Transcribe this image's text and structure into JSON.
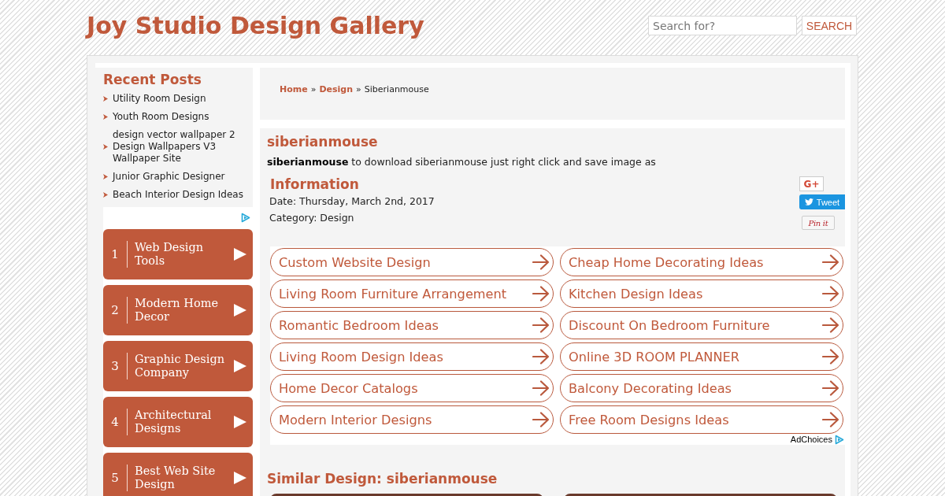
{
  "site_title": "Joy Studio Design Gallery",
  "search": {
    "placeholder": "Search for?",
    "button": "SEARCH"
  },
  "sidebar": {
    "recent_posts": {
      "title": "Recent Posts",
      "items": [
        "Utility Room Design",
        "Youth Room Designs",
        "design vector wallpaper 2 Design Wallpapers V3 Wallpaper Site",
        "Junior Graphic Designer",
        "Beach Interior Design Ideas"
      ]
    },
    "ad_links": [
      {
        "number": "1",
        "label": "Web Design Tools"
      },
      {
        "number": "2",
        "label": "Modern Home Decor"
      },
      {
        "number": "3",
        "label": "Graphic Design Company"
      },
      {
        "number": "4",
        "label": "Architectural Designs"
      },
      {
        "number": "5",
        "label": "Best Web Site Design"
      }
    ]
  },
  "breadcrumb": [
    {
      "kind": "link",
      "label": "Home"
    },
    {
      "kind": "separator",
      "label": "»"
    },
    {
      "kind": "link",
      "label": "Design"
    },
    {
      "kind": "separator",
      "label": "»"
    },
    {
      "kind": "current",
      "label": "Siberianmouse"
    }
  ],
  "post": {
    "title": "siberianmouse",
    "description": "**siberianmouse** to download siberianmouse just right click and save image as",
    "info_title": "Information",
    "date": "Date: Thursday, March 2nd, 2017",
    "category": "Category: Design"
  },
  "share_buttons": [
    {
      "kind": "google",
      "label": "G+"
    },
    {
      "kind": "twitter",
      "label": "Tweet"
    },
    {
      "kind": "pinterest",
      "label": "Pin it"
    }
  ],
  "ad_links": [
    "Custom Website Design",
    "Cheap Home Decorating Ideas",
    "Living Room Furniture Arrangement",
    "Kitchen Design Ideas",
    "Romantic Bedroom Ideas",
    "Discount On Bedroom Furniture",
    "Living Room Design Ideas",
    "Online 3D ROOM PLANNER",
    "Home Decor Catalogs",
    "Balcony Decorating Ideas",
    "Modern Interior Designs",
    "Free Room Designs Ideas"
  ],
  "ad_choices": "AdChoices",
  "similar": {
    "title": "Similar Design: siberianmouse"
  }
}
